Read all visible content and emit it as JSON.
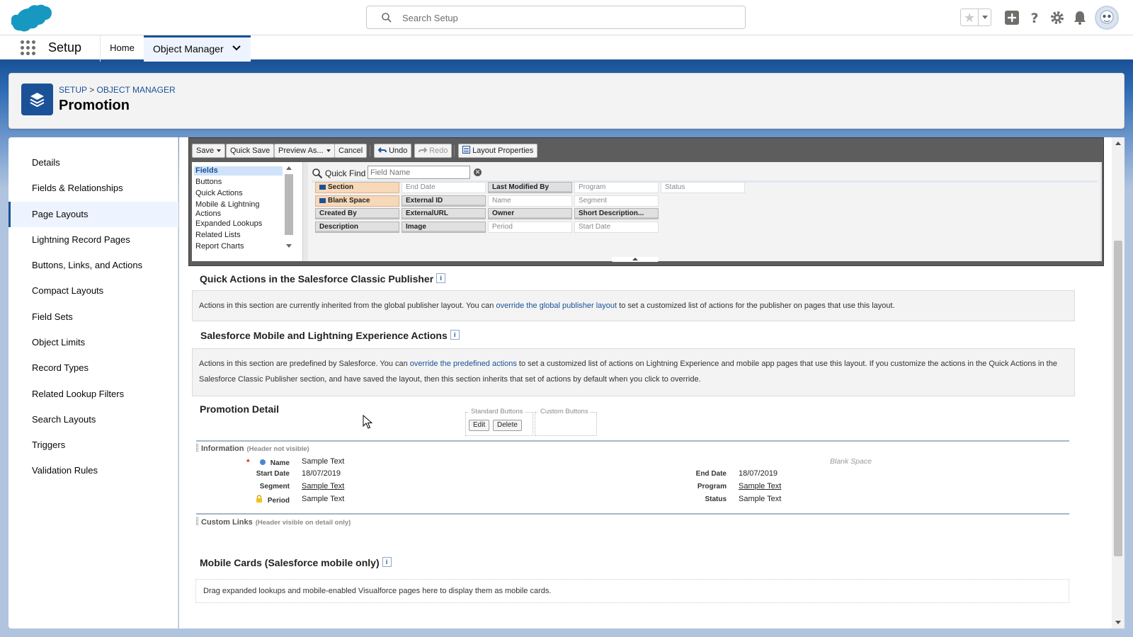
{
  "header": {
    "search_placeholder": "Search Setup",
    "icons": [
      "favorites-star-icon",
      "add-icon",
      "help-icon",
      "settings-gear-icon",
      "notification-bell-icon",
      "avatar"
    ]
  },
  "context_bar": {
    "app_name": "Setup",
    "tabs": [
      {
        "label": "Home"
      },
      {
        "label": "Object Manager",
        "active": true
      }
    ]
  },
  "page_header": {
    "breadcrumb_setup": "SETUP",
    "breadcrumb_sep": ">",
    "breadcrumb_om": "OBJECT MANAGER",
    "title": "Promotion"
  },
  "sidebar": {
    "items": [
      {
        "label": "Details"
      },
      {
        "label": "Fields & Relationships"
      },
      {
        "label": "Page Layouts",
        "active": true
      },
      {
        "label": "Lightning Record Pages"
      },
      {
        "label": "Buttons, Links, and Actions"
      },
      {
        "label": "Compact Layouts"
      },
      {
        "label": "Field Sets"
      },
      {
        "label": "Object Limits"
      },
      {
        "label": "Record Types"
      },
      {
        "label": "Related Lookup Filters"
      },
      {
        "label": "Search Layouts"
      },
      {
        "label": "Triggers"
      },
      {
        "label": "Validation Rules"
      }
    ]
  },
  "toolbar": {
    "save": "Save",
    "quick_save": "Quick Save",
    "preview_as": "Preview As...",
    "cancel": "Cancel",
    "undo": "Undo",
    "redo": "Redo",
    "layout_properties": "Layout Properties"
  },
  "palette": {
    "categories": [
      "Fields",
      "Buttons",
      "Quick Actions",
      "Mobile & Lightning Actions",
      "Expanded Lookups",
      "Related Lists",
      "Report Charts"
    ],
    "quick_find_label": "Quick Find",
    "quick_find_placeholder": "Field Name",
    "fields": [
      {
        "label": "Section",
        "state": "special"
      },
      {
        "label": "End Date",
        "state": "used"
      },
      {
        "label": "Last Modified By",
        "state": "avail"
      },
      {
        "label": "Program",
        "state": "used"
      },
      {
        "label": "Status",
        "state": "used"
      },
      {
        "label": "Blank Space",
        "state": "special"
      },
      {
        "label": "External ID",
        "state": "avail"
      },
      {
        "label": "Name",
        "state": "used"
      },
      {
        "label": "Segment",
        "state": "used"
      },
      {
        "label": "Created By",
        "state": "avail"
      },
      {
        "label": "ExternalURL",
        "state": "avail"
      },
      {
        "label": "Owner",
        "state": "avail"
      },
      {
        "label": "Short Description...",
        "state": "avail"
      },
      {
        "label": "Description",
        "state": "avail"
      },
      {
        "label": "Image",
        "state": "avail"
      },
      {
        "label": "Period",
        "state": "used"
      },
      {
        "label": "Start Date",
        "state": "used"
      }
    ]
  },
  "layout": {
    "quick_actions_title": "Quick Actions in the Salesforce Classic Publisher",
    "quick_actions_text_1": "Actions in this section are currently inherited from the global publisher layout. You can ",
    "quick_actions_link": "override the global publisher layout",
    "quick_actions_text_2": " to set a customized list of actions for the publisher on pages that use this layout.",
    "mobile_actions_title": "Salesforce Mobile and Lightning Experience Actions",
    "mobile_actions_text_1": "Actions in this section are predefined by Salesforce. You can ",
    "mobile_actions_link": "override the predefined actions",
    "mobile_actions_text_2": " to set a customized list of actions on Lightning Experience and mobile app pages that use this layout. If you customize the actions in the Quick Actions in the Salesforce Classic Publisher section, and have saved the layout, then this section inherits that set of actions by default when you click to override.",
    "detail_title": "Promotion Detail",
    "standard_buttons_label": "Standard Buttons",
    "custom_buttons_label": "Custom Buttons",
    "edit_btn": "Edit",
    "delete_btn": "Delete",
    "info_section": "Information",
    "info_note": "(Header not visible)",
    "fields_left": [
      {
        "label": "Name",
        "value": "Sample Text"
      },
      {
        "label": "Start Date",
        "value": "18/07/2019"
      },
      {
        "label": "Segment",
        "value": "Sample Text"
      },
      {
        "label": "Period",
        "value": "Sample Text"
      }
    ],
    "blank_space": "Blank Space",
    "fields_right": [
      {
        "label": "End Date",
        "value": "18/07/2019"
      },
      {
        "label": "Program",
        "value": "Sample Text"
      },
      {
        "label": "Status",
        "value": "Sample Text"
      }
    ],
    "custom_links_section": "Custom Links",
    "custom_links_note": "(Header visible on detail only)",
    "mobile_cards_title": "Mobile Cards (Salesforce mobile only)",
    "mobile_cards_text": "Drag expanded lookups and mobile-enabled Visualforce pages here to display them as mobile cards.",
    "info_icon_text": "i"
  },
  "colors": {
    "brand": "#1b5297",
    "link": "#1b5297",
    "required": "#e52424"
  }
}
